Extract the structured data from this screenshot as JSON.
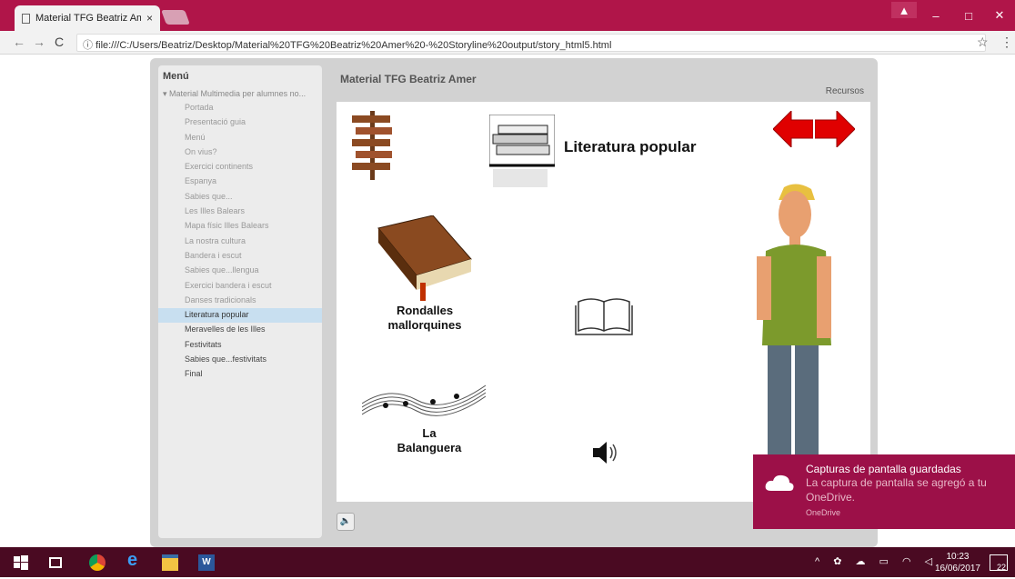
{
  "browser": {
    "tab_title": "Material TFG Beatriz Amer",
    "tab_close": "×",
    "url": "file:///C:/Users/Beatriz/Desktop/Material%20TFG%20Beatriz%20Amer%20-%20Storyline%20output/story_html5.html"
  },
  "sidebar": {
    "heading": "Menú",
    "root": "Material Multimedia per alumnes no...",
    "items": [
      {
        "label": "Portada"
      },
      {
        "label": "Presentació guia"
      },
      {
        "label": "Menú"
      },
      {
        "label": "On vius?"
      },
      {
        "label": "Exercici continents"
      },
      {
        "label": "Espanya"
      },
      {
        "label": "Sabies que..."
      },
      {
        "label": "Les Illes Balears"
      },
      {
        "label": "Mapa físic Illes Balears"
      },
      {
        "label": "La nostra cultura"
      },
      {
        "label": "Bandera i escut"
      },
      {
        "label": "Sabies que...llengua"
      },
      {
        "label": "Exercici bandera i escut"
      },
      {
        "label": "Danses tradicionals"
      },
      {
        "label": "Literatura popular"
      },
      {
        "label": "Meravelles de les Illes"
      },
      {
        "label": "Festivitats"
      },
      {
        "label": "Sabies que...festivitats"
      },
      {
        "label": "Final"
      }
    ],
    "current_index": 14
  },
  "stage": {
    "title": "Material TFG Beatriz Amer",
    "resources": "Recursos",
    "slide_heading": "Literatura popular",
    "rondalles": "Rondalles mallorquines",
    "balanguera_1": "La",
    "balanguera_2": "Balanguera"
  },
  "toast": {
    "title": "Capturas de pantalla guardadas",
    "body": "La captura de pantalla se agregó a tu OneDrive.",
    "source": "OneDrive"
  },
  "taskbar": {
    "time": "10:23",
    "date": "16/06/2017",
    "notifications": "22"
  },
  "colors": {
    "chrome_accent": "#b01549",
    "taskbar": "#4a0a22",
    "toast": "#9c1048",
    "arrow": "#e00000"
  }
}
